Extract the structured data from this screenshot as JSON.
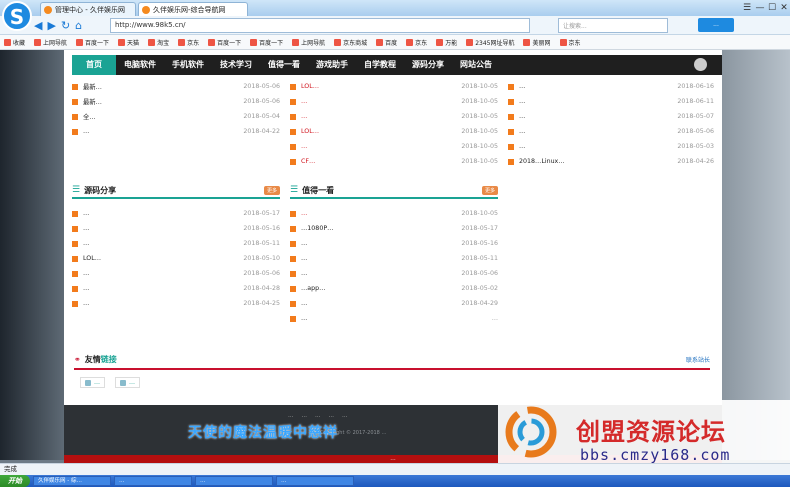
{
  "browser": {
    "logo": "S",
    "tabs": [
      {
        "label": "管理中心 - 久伴娱乐网"
      },
      {
        "label": "久伴娱乐网-综合导航网"
      }
    ],
    "url": "http://www.98k5.cn/",
    "search_placeholder": "让搜索...",
    "login_label": "...",
    "nav_glyphs": [
      "◀",
      "▶",
      "↻",
      "⌂"
    ],
    "window_controls": [
      "☰",
      "—",
      "☐",
      "✕"
    ]
  },
  "bookmarks": [
    "收藏",
    "上网导航",
    "百度一下",
    "天猫",
    "淘宝",
    "京东",
    "百度一下",
    "百度一下",
    "上网导航",
    "京东商城",
    "百度",
    "京东",
    "万能",
    "2345网址导航",
    "美丽网",
    "京东"
  ],
  "nav": {
    "items": [
      "首页",
      "电脑软件",
      "手机软件",
      "技术学习",
      "值得一看",
      "游戏助手",
      "自学教程",
      "源码分享",
      "网站公告"
    ]
  },
  "columns": {
    "col1_top": [
      {
        "title": "最新…",
        "date": "2018-05-06"
      },
      {
        "title": "最新…",
        "date": "2018-05-06"
      },
      {
        "title": "全…",
        "date": "2018-05-04"
      },
      {
        "title": "…",
        "date": "2018-04-22"
      }
    ],
    "col2_top": [
      {
        "title": "LOL…",
        "date": "2018-10-05"
      },
      {
        "title": "…",
        "date": "2018-10-05"
      },
      {
        "title": "…",
        "date": "2018-10-05"
      },
      {
        "title": "LOL…",
        "date": "2018-10-05"
      },
      {
        "title": "…",
        "date": "2018-10-05"
      },
      {
        "title": "CF…",
        "date": "2018-10-05"
      }
    ],
    "col3": [
      {
        "title": "…",
        "date": "2018-06-16"
      },
      {
        "title": "…",
        "date": "2018-06-11"
      },
      {
        "title": "…",
        "date": "2018-05-07"
      },
      {
        "title": "…",
        "date": "2018-05-06"
      },
      {
        "title": "…",
        "date": "2018-05-03"
      },
      {
        "title": "2018…Linux…",
        "date": "2018-04-26"
      }
    ]
  },
  "section_source": {
    "title": "源码分享",
    "more": "更多",
    "items": [
      {
        "title": "…",
        "date": "2018-05-17"
      },
      {
        "title": "…",
        "date": "2018-05-16"
      },
      {
        "title": "…",
        "date": "2018-05-11"
      },
      {
        "title": "LOL…",
        "date": "2018-05-10"
      },
      {
        "title": "…",
        "date": "2018-05-06"
      },
      {
        "title": "…",
        "date": "2018-04-28"
      },
      {
        "title": "…",
        "date": "2018-04-25"
      }
    ]
  },
  "section_worth": {
    "title": "值得一看",
    "more": "更多",
    "items": [
      {
        "title": "…",
        "date": "2018-10-05"
      },
      {
        "title": "…1080P…",
        "date": "2018-05-17"
      },
      {
        "title": "…",
        "date": "2018-05-16"
      },
      {
        "title": "…",
        "date": "2018-05-11"
      },
      {
        "title": "…",
        "date": "2018-05-06"
      },
      {
        "title": "…app…",
        "date": "2018-05-02"
      },
      {
        "title": "…",
        "date": "2018-04-29"
      },
      {
        "title": "…",
        "date": "…"
      }
    ]
  },
  "friend_links": {
    "title_a": "友情",
    "title_b": "链接",
    "apply": "联系站长",
    "links": [
      "…",
      "…"
    ]
  },
  "footer": {
    "links": [
      "…",
      "…",
      "…",
      "…",
      "…"
    ],
    "copyright": "Copyright © 2017-2018 …",
    "notice": "…"
  },
  "overlay_text": "天使的魔法温暖中慈祥",
  "watermark": {
    "name": "创盟资源论坛",
    "url": "bbs.cmzy168.com"
  },
  "statusbar": {
    "text": "完成"
  },
  "taskbar": {
    "start": "开始",
    "items": [
      "久伴娱乐网 - 综…",
      "…",
      "…",
      "…"
    ]
  },
  "colors": {
    "teal": "#1aa394",
    "orange": "#f27b1c",
    "red": "#d0121b"
  }
}
